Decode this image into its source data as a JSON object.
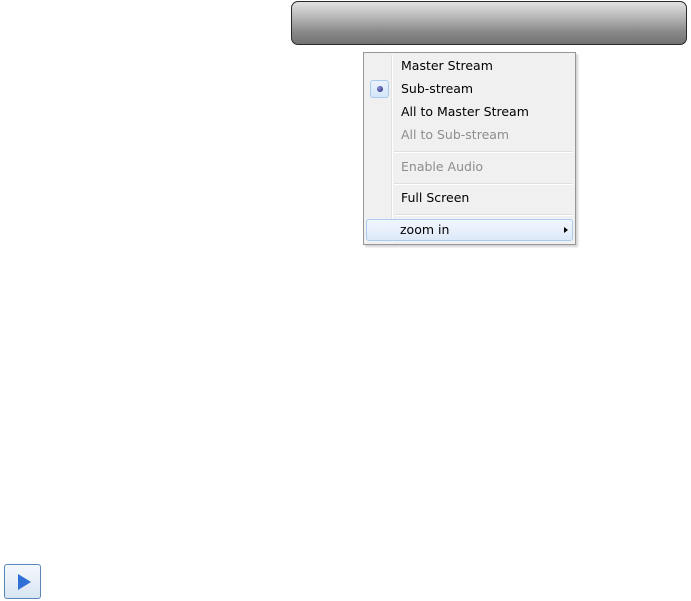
{
  "context_menu": {
    "items": [
      {
        "label": "Master Stream",
        "enabled": true,
        "checked": false
      },
      {
        "label": "Sub-stream",
        "enabled": true,
        "checked": true
      },
      {
        "label": "All to Master Stream",
        "enabled": true,
        "checked": false
      },
      {
        "label": "All to Sub-stream",
        "enabled": false,
        "checked": false
      },
      {
        "label": "Enable Audio",
        "enabled": false,
        "checked": false
      },
      {
        "label": "Full Screen",
        "enabled": true,
        "checked": false
      },
      {
        "label": "zoom in",
        "enabled": true,
        "checked": false,
        "has_submenu": true,
        "highlighted": true
      }
    ]
  },
  "icons": {
    "radio_mark": "radio-dot-icon",
    "submenu_arrow": "chevron-right-icon",
    "play": "play-icon"
  },
  "colors": {
    "menu_background": "#f0f0f0",
    "disabled_text": "#8d8d8d",
    "highlight_border": "#aaccf1",
    "play_accent": "#2f6fd6"
  }
}
